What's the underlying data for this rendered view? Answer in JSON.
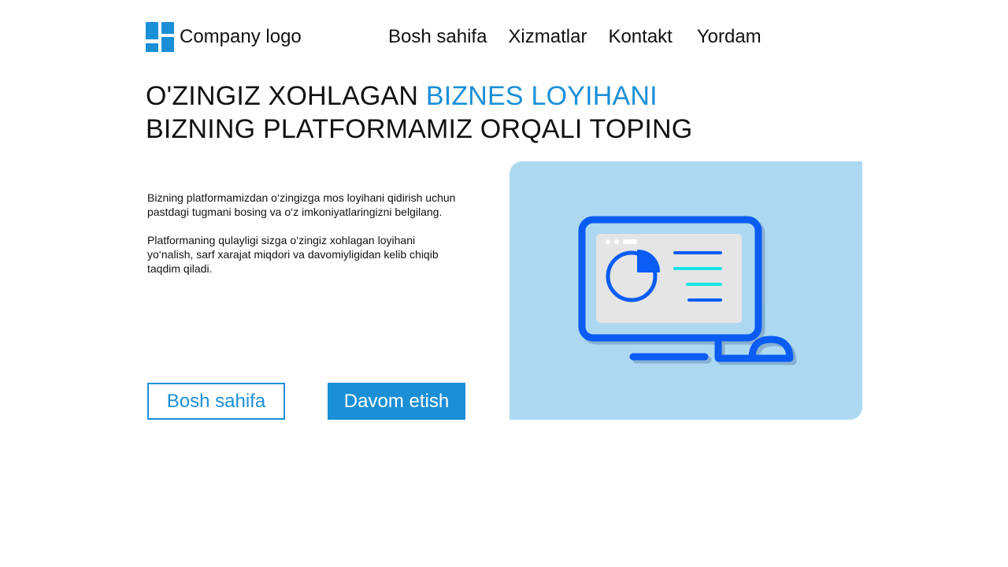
{
  "header": {
    "logo_text": "Company logo",
    "nav": [
      "Bosh sahifa",
      "Xizmatlar",
      "Kontakt",
      "Yordam"
    ]
  },
  "hero": {
    "title_line1_plain": "O'ZINGIZ XOHLAGAN ",
    "title_line1_accent": "BIZNES LOYIHANI",
    "title_line2": "BIZNING PLATFORMAMIZ ORQALI TOPING"
  },
  "content": {
    "paragraph1": "Bizning platformamizdan o‘zingizga mos loyihani qidirish uchun pastdagi tugmani bosing va o‘z imkoniyatlaringizni belgilang.",
    "paragraph2": "Platformaning qulayligi sizga o‘zingiz xohlagan loyihani yo‘nalish, sarf xarajat miqdori va davomiyligidan kelib chiqib taqdim qiladi."
  },
  "buttons": {
    "secondary_label": "Bosh sahifa",
    "primary_label": "Davom etish"
  },
  "illustration": {
    "icon": "computer-monitor-chart-icon"
  },
  "colors": {
    "accent": "#1a8fd6",
    "panel_bg": "#acd8f2",
    "monitor_blue": "#0a5cf5",
    "screen_bg": "#e5e5e5",
    "cyan_line": "#19e3e8",
    "text": "#111111"
  }
}
